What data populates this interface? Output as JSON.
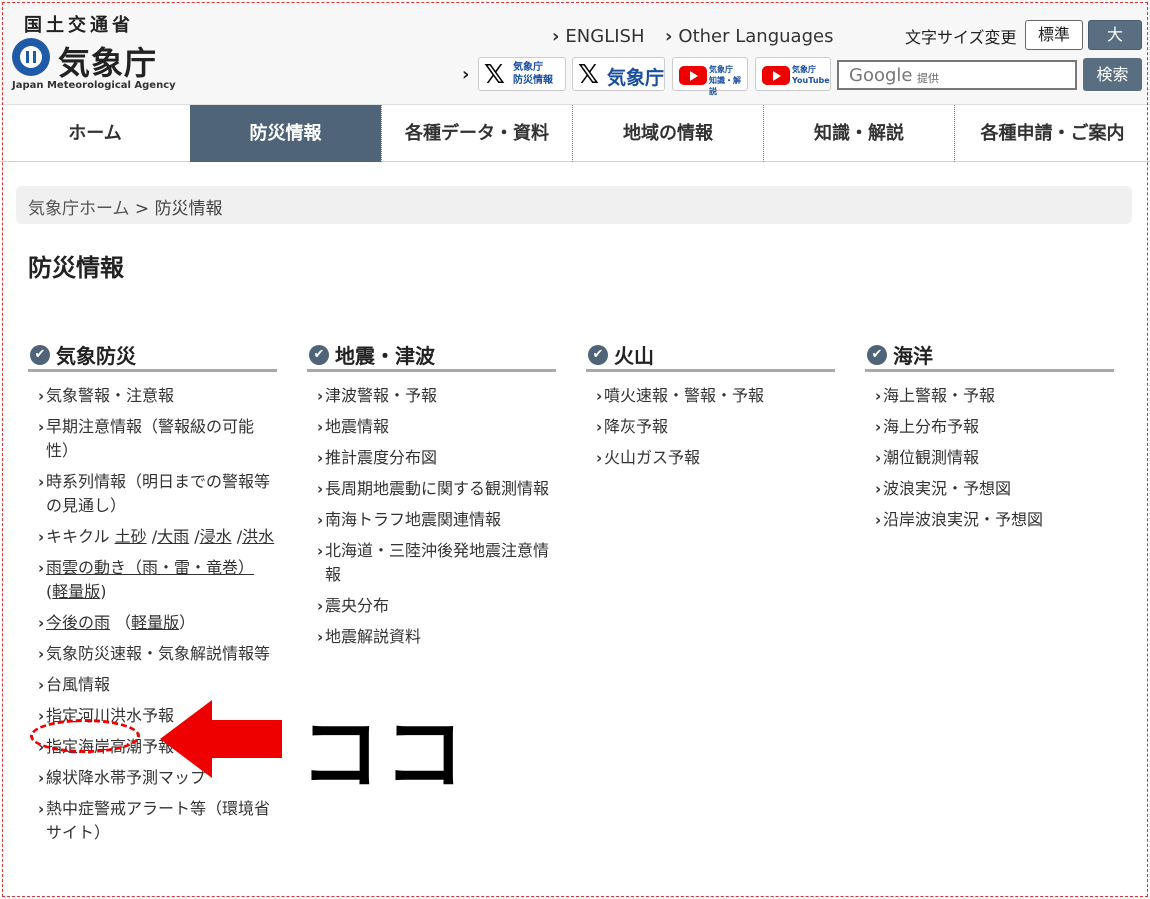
{
  "header": {
    "ministry": "国土交通省",
    "agency_jp": "気象庁",
    "agency_en": "Japan Meteorological Agency",
    "english": "ENGLISH",
    "other_languages": "Other Languages",
    "fontsize_label": "文字サイズ変更",
    "fontsize_standard": "標準",
    "fontsize_large": "大",
    "sns": {
      "x_bousai_line1": "気象庁",
      "x_bousai_line2": "防災情報",
      "x_jma": "気象庁",
      "yt_chishiki_line1": "気象庁",
      "yt_chishiki_line2": "知識・解説",
      "yt_main_line1": "気象庁",
      "yt_main_line2": "YouTube"
    },
    "search_google": "Google",
    "search_provided": "提供",
    "search_button": "検索"
  },
  "nav": {
    "items": [
      {
        "label": "ホーム"
      },
      {
        "label": "防災情報"
      },
      {
        "label": "各種データ・資料"
      },
      {
        "label": "地域の情報"
      },
      {
        "label": "知識・解説"
      },
      {
        "label": "各種申請・ご案内"
      }
    ],
    "active_index": 1
  },
  "breadcrumb": {
    "home": "気象庁ホーム",
    "separator": ">",
    "current": "防災情報"
  },
  "page_title": "防災情報",
  "columns": [
    {
      "heading": "気象防災",
      "items": [
        {
          "text": "気象警報・注意報"
        },
        {
          "text": "早期注意情報（警報級の可能性）"
        },
        {
          "text": "時系列情報（明日までの警報等の見通し）"
        },
        {
          "prefix": "キキクル",
          "links": [
            "土砂",
            "大雨",
            "浸水",
            "洪水"
          ]
        },
        {
          "link": "雨雲の動き（雨・雷・竜巻）",
          "paren_link": "軽量版"
        },
        {
          "link": "今後の雨",
          "paren_link": "軽量版"
        },
        {
          "text": "気象防災速報・気象解説情報等"
        },
        {
          "text": "台風情報"
        },
        {
          "text": "指定河川洪水予報"
        },
        {
          "text": "指定海岸高潮予報"
        },
        {
          "text": "線状降水帯予測マップ"
        },
        {
          "text": "熱中症警戒アラート等（環境省サイト）"
        }
      ]
    },
    {
      "heading": "地震・津波",
      "items": [
        {
          "text": "津波警報・予報"
        },
        {
          "text": "地震情報"
        },
        {
          "text": "推計震度分布図"
        },
        {
          "text": "長周期地震動に関する観測情報"
        },
        {
          "text": "南海トラフ地震関連情報"
        },
        {
          "text": "北海道・三陸沖後発地震注意情報"
        },
        {
          "text": "震央分布"
        },
        {
          "text": "地震解説資料"
        }
      ]
    },
    {
      "heading": "火山",
      "items": [
        {
          "text": "噴火速報・警報・予報"
        },
        {
          "text": "降灰予報"
        },
        {
          "text": "火山ガス予報"
        }
      ]
    },
    {
      "heading": "海洋",
      "items": [
        {
          "text": "海上警報・予報"
        },
        {
          "text": "海上分布予報"
        },
        {
          "text": "潮位観測情報"
        },
        {
          "text": "波浪実況・予想図"
        },
        {
          "text": "沿岸波浪実況・予想図"
        }
      ]
    }
  ],
  "annotation": {
    "label": "ココ",
    "arrow_color": "#ee0000"
  }
}
